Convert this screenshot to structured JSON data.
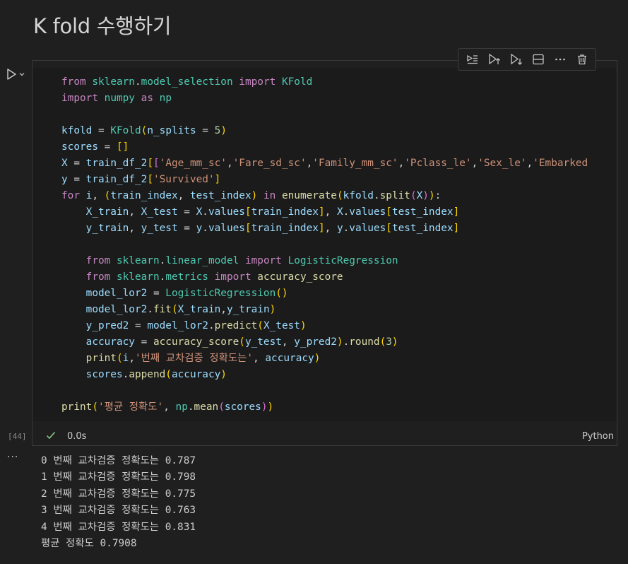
{
  "markdown": {
    "heading": "K fold 수행하기"
  },
  "toolbar": {
    "buttons": [
      {
        "name": "run-by-line-icon"
      },
      {
        "name": "execute-above-icon"
      },
      {
        "name": "execute-below-icon"
      },
      {
        "name": "split-cell-icon"
      },
      {
        "name": "more-icon"
      },
      {
        "name": "delete-icon"
      }
    ]
  },
  "cell": {
    "execution_count": "[44]",
    "status_time": "0.0s",
    "kernel_language": "Python",
    "code": [
      "from sklearn.model_selection import KFold",
      "import numpy as np",
      "",
      "kfold = KFold(n_splits = 5)",
      "scores = []",
      "X = train_df_2[['Age_mm_sc','Fare_sd_sc','Family_mm_sc','Pclass_le','Sex_le','Embarked",
      "y = train_df_2['Survived']",
      "for i, (train_index, test_index) in enumerate(kfold.split(X)):",
      "    X_train, X_test = X.values[train_index], X.values[test_index]",
      "    y_train, y_test = y.values[train_index], y.values[test_index]",
      "",
      "    from sklearn.linear_model import LogisticRegression",
      "    from sklearn.metrics import accuracy_score",
      "    model_lor2 = LogisticRegression()",
      "    model_lor2.fit(X_train,y_train)",
      "    y_pred2 = model_lor2.predict(X_test)",
      "    accuracy = accuracy_score(y_test, y_pred2).round(3)",
      "    print(i,'번째 교차검증 정확도는', accuracy)",
      "    scores.append(accuracy)",
      "",
      "print('평균 정확도', np.mean(scores))"
    ]
  },
  "output": {
    "lines": [
      "0 번째 교차검증 정확도는 0.787",
      "1 번째 교차검증 정확도는 0.798",
      "2 번째 교차검증 정확도는 0.775",
      "3 번째 교차검증 정확도는 0.763",
      "4 번째 교차검증 정확도는 0.831",
      "평균 정확도 0.7908"
    ]
  },
  "colors": {
    "background": "#1f1f1f",
    "editor_background": "#1b1b1b",
    "keyword": "#c586c0",
    "module": "#4ec9b0",
    "variable": "#9cdcfe",
    "string": "#ce9178",
    "number": "#b5cea8",
    "function": "#dcdcaa",
    "success_check": "#89d185"
  }
}
